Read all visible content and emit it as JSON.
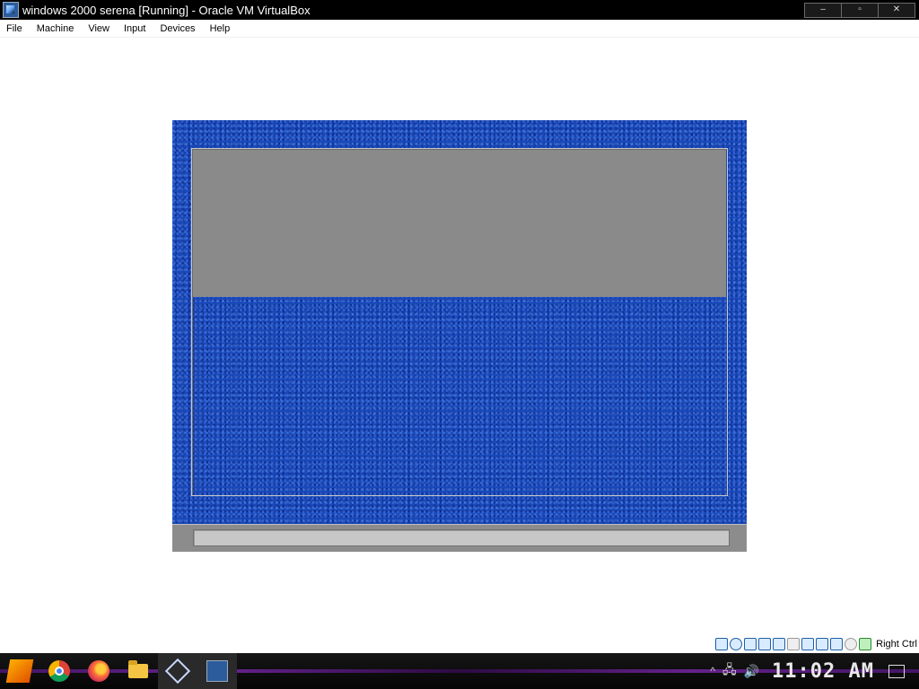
{
  "window": {
    "title": "windows 2000 serena [Running] - Oracle VM VirtualBox",
    "controls": {
      "minimize": "–",
      "maximize": "▫",
      "close": "✕"
    }
  },
  "menubar": {
    "items": [
      {
        "label": "File"
      },
      {
        "label": "Machine"
      },
      {
        "label": "View"
      },
      {
        "label": "Input"
      },
      {
        "label": "Devices"
      },
      {
        "label": "Help"
      }
    ]
  },
  "status_bar": {
    "icons": [
      "hard-disk-icon",
      "optical-drive-icon",
      "audio-icon",
      "network-icon",
      "usb-icon",
      "shared-folder-icon",
      "display-icon",
      "video-capture-icon",
      "vm-window-icon",
      "cpu-icon",
      "mouse-integration-icon",
      "keyboard-icon"
    ],
    "host_key": "Right Ctrl"
  },
  "taskbar": {
    "apps": [
      "start-icon",
      "chrome-icon",
      "firefox-icon",
      "file-explorer-icon",
      "virtualbox-icon",
      "vm-window-icon"
    ],
    "tray": {
      "chevron": "^",
      "network": "🖧",
      "volume": "🔊"
    },
    "clock": "11:02 AM"
  },
  "colors": {
    "guest_background": "#1848b8",
    "guest_panel": "#8a8a8a",
    "taskbar_accent": "#8a2ac0"
  }
}
